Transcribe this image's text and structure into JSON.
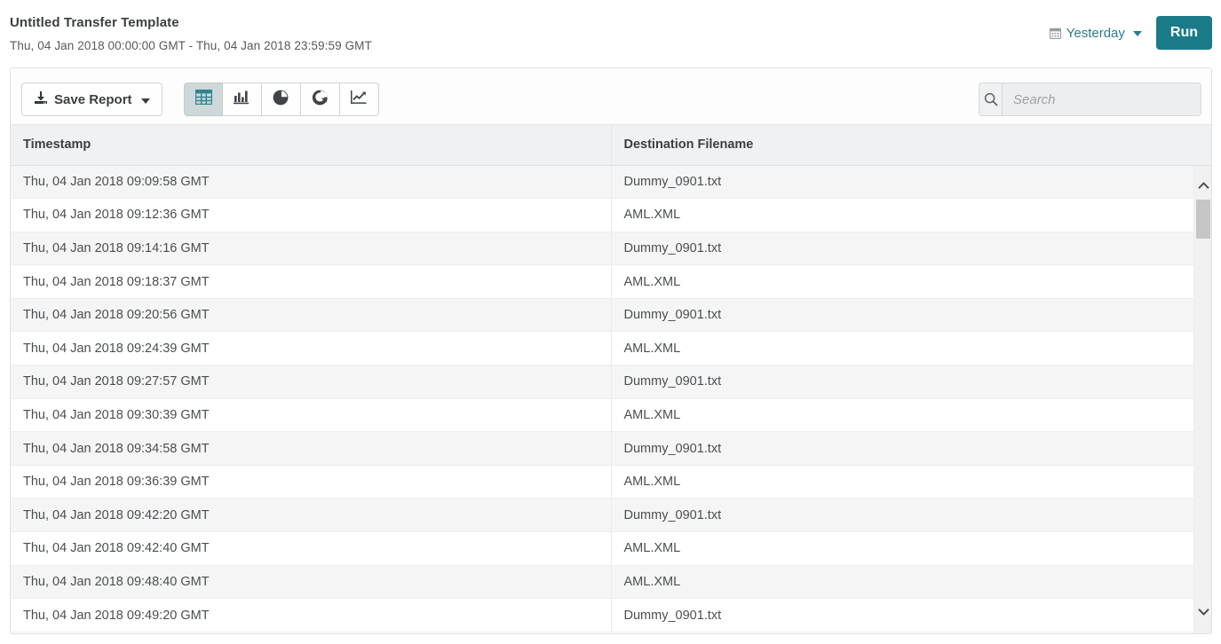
{
  "header": {
    "title": "Untitled Transfer Template",
    "date_range": "Thu, 04 Jan 2018 00:00:00 GMT - Thu, 04 Jan 2018 23:59:59 GMT",
    "daterange_label": "Yesterday",
    "daterange_icon": "calendar-icon",
    "caret_icon": "caret-down-icon",
    "run_label": "Run"
  },
  "toolbar": {
    "save_label": "Save Report",
    "save_icon": "download-icon",
    "views": [
      {
        "name": "table",
        "icon": "table-grid-icon",
        "active": true
      },
      {
        "name": "bar",
        "icon": "bar-chart-icon",
        "active": false
      },
      {
        "name": "pie",
        "icon": "pie-chart-icon",
        "active": false
      },
      {
        "name": "donut",
        "icon": "donut-chart-icon",
        "active": false
      },
      {
        "name": "line",
        "icon": "line-chart-icon",
        "active": false
      }
    ]
  },
  "search": {
    "placeholder": "Search",
    "value": "",
    "icon": "search-icon"
  },
  "table": {
    "columns": [
      "Timestamp",
      "Destination Filename"
    ],
    "rows": [
      [
        "Thu, 04 Jan 2018 09:09:58 GMT",
        "Dummy_0901.txt"
      ],
      [
        "Thu, 04 Jan 2018 09:12:36 GMT",
        "AML.XML"
      ],
      [
        "Thu, 04 Jan 2018 09:14:16 GMT",
        "Dummy_0901.txt"
      ],
      [
        "Thu, 04 Jan 2018 09:18:37 GMT",
        "AML.XML"
      ],
      [
        "Thu, 04 Jan 2018 09:20:56 GMT",
        "Dummy_0901.txt"
      ],
      [
        "Thu, 04 Jan 2018 09:24:39 GMT",
        "AML.XML"
      ],
      [
        "Thu, 04 Jan 2018 09:27:57 GMT",
        "Dummy_0901.txt"
      ],
      [
        "Thu, 04 Jan 2018 09:30:39 GMT",
        "AML.XML"
      ],
      [
        "Thu, 04 Jan 2018 09:34:58 GMT",
        "Dummy_0901.txt"
      ],
      [
        "Thu, 04 Jan 2018 09:36:39 GMT",
        "AML.XML"
      ],
      [
        "Thu, 04 Jan 2018 09:42:20 GMT",
        "Dummy_0901.txt"
      ],
      [
        "Thu, 04 Jan 2018 09:42:40 GMT",
        "AML.XML"
      ],
      [
        "Thu, 04 Jan 2018 09:48:40 GMT",
        "AML.XML"
      ],
      [
        "Thu, 04 Jan 2018 09:49:20 GMT",
        "Dummy_0901.txt"
      ]
    ]
  },
  "scrollbar": {
    "up_icon": "chevron-up-icon",
    "down_icon": "chevron-down-icon",
    "thumb": "scroll-thumb"
  },
  "colors": {
    "accent": "#197b87",
    "link": "#2a7d8c",
    "row_stripe": "#f5f5f6",
    "header_bg": "#f0f1f2"
  }
}
